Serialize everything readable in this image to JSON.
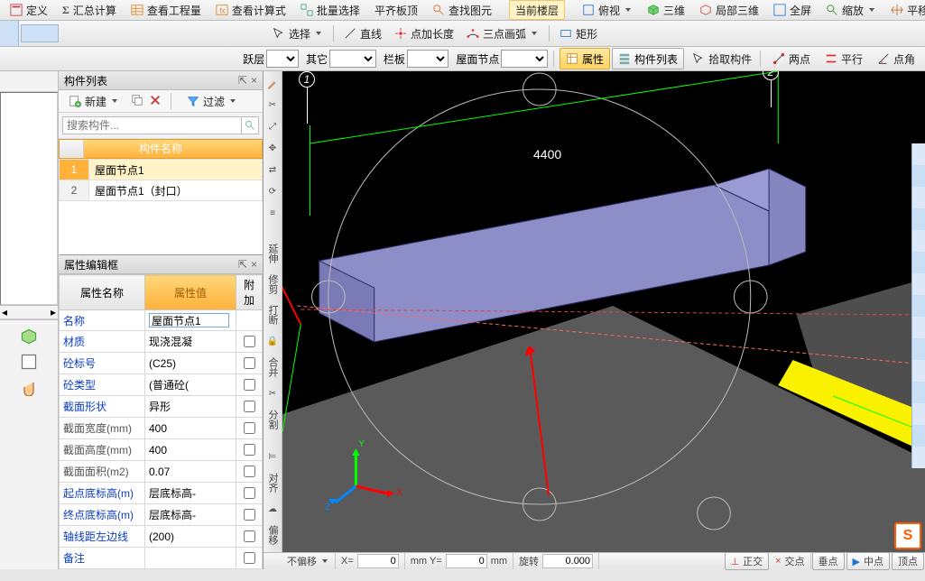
{
  "menu1": {
    "items": [
      "定义",
      "汇总计算",
      "查看工程量",
      "查看计算式",
      "批量选择",
      "平齐板顶",
      "查找图元",
      "当前楼层",
      "俯视",
      "三维",
      "局部三维",
      "全屏",
      "缩放",
      "平移"
    ]
  },
  "toolbar_draw": {
    "select": "选择",
    "line": "直线",
    "arc_add": "点加长度",
    "arc3": "三点画弧",
    "rect": "矩形"
  },
  "toolbar_filter": {
    "floor": "跃层",
    "other": "其它",
    "slab": "栏板",
    "roof": "屋面节点",
    "attr": "属性",
    "comp_list": "构件列表",
    "pick": "拾取构件",
    "two_pt": "两点",
    "parallel": "平行",
    "pt_angle": "点角"
  },
  "left_panel": {
    "title": "构件列表",
    "new": "新建",
    "filter": "过滤",
    "search_placeholder": "搜索构件...",
    "col_name": "构件名称",
    "rows": [
      {
        "n": "1",
        "name": "屋面节点1"
      },
      {
        "n": "2",
        "name": "屋面节点1（封口）"
      }
    ]
  },
  "prop_panel": {
    "title": "属性编辑框",
    "h_name": "属性名称",
    "h_val": "属性值",
    "h_ext": "附加",
    "rows": [
      {
        "k": "名称",
        "v": "屋面节点1",
        "blue": true,
        "edit": true
      },
      {
        "k": "材质",
        "v": "现浇混凝",
        "blue": true
      },
      {
        "k": "砼标号",
        "v": "(C25)",
        "blue": true
      },
      {
        "k": "砼类型",
        "v": "(普通砼(",
        "blue": true
      },
      {
        "k": "截面形状",
        "v": "异形",
        "blue": true
      },
      {
        "k": "截面宽度(mm)",
        "v": "400",
        "blue": false
      },
      {
        "k": "截面高度(mm)",
        "v": "400",
        "blue": false
      },
      {
        "k": "截面面积(m2)",
        "v": "0.07",
        "blue": false
      },
      {
        "k": "起点底标高(m)",
        "v": "层底标高-",
        "blue": true
      },
      {
        "k": "终点底标高(m)",
        "v": "层底标高-",
        "blue": true
      },
      {
        "k": "轴线距左边线",
        "v": "(200)",
        "blue": true
      },
      {
        "k": "备注",
        "v": "",
        "blue": true
      }
    ]
  },
  "vtools": [
    "延伸",
    "修剪",
    "打断",
    "合并",
    "分割",
    "对齐",
    "偏移"
  ],
  "viewport": {
    "dim": "4400",
    "n1": "1",
    "n2": "2"
  },
  "status": {
    "no_offset": "不偏移",
    "x": "X=",
    "y": "mm Y=",
    "mm": "mm",
    "rotate": "旋转",
    "deg": "0.000",
    "ortho": "正交",
    "osnap": "交点",
    "perp": "垂点",
    "mid": "中点",
    "apex": "顶点"
  },
  "icons": {
    "pin": "⊼",
    "close": "×",
    "search": "🔍",
    "new": "✚",
    "copy": "⧉",
    "del": "🗑",
    "funnel": "▼"
  }
}
